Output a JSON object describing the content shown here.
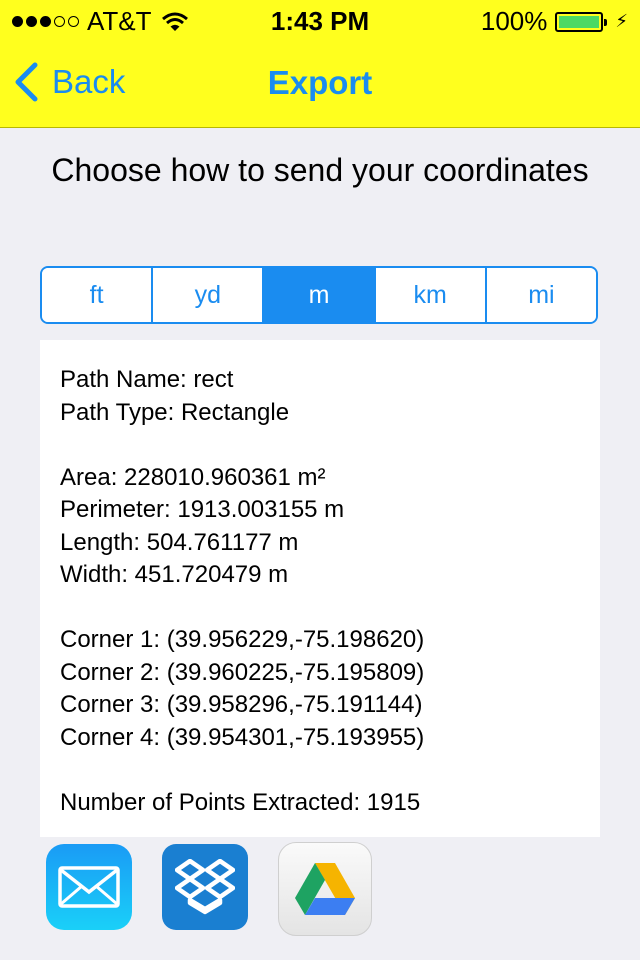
{
  "status_bar": {
    "carrier": "AT&T",
    "time": "1:43 PM",
    "battery_percent": "100%",
    "signal_bars_filled": 3,
    "signal_bars_total": 5
  },
  "nav": {
    "back_label": "Back",
    "title": "Export"
  },
  "heading": "Choose how to send your coordinates",
  "units": {
    "options": [
      "ft",
      "yd",
      "m",
      "km",
      "mi"
    ],
    "selected": "m"
  },
  "details": {
    "path_name": "Path Name: rect",
    "path_type": "Path Type: Rectangle",
    "area": "Area: 228010.960361 m²",
    "perimeter": "Perimeter: 1913.003155 m",
    "length": "Length: 504.761177 m",
    "width": "Width: 451.720479 m",
    "corners": [
      "Corner 1: (39.956229,-75.198620)",
      "Corner 2: (39.960225,-75.195809)",
      "Corner 3: (39.958296,-75.191144)",
      "Corner 4: (39.954301,-75.193955)"
    ],
    "points_extracted": "Number of Points Extracted: 1915"
  },
  "share_targets": [
    "mail-icon",
    "dropbox-icon",
    "google-drive-icon"
  ],
  "colors": {
    "header_bg": "#ffff1e",
    "accent": "#1a8cf0",
    "page_bg": "#efeff4",
    "battery": "#4cd964"
  }
}
